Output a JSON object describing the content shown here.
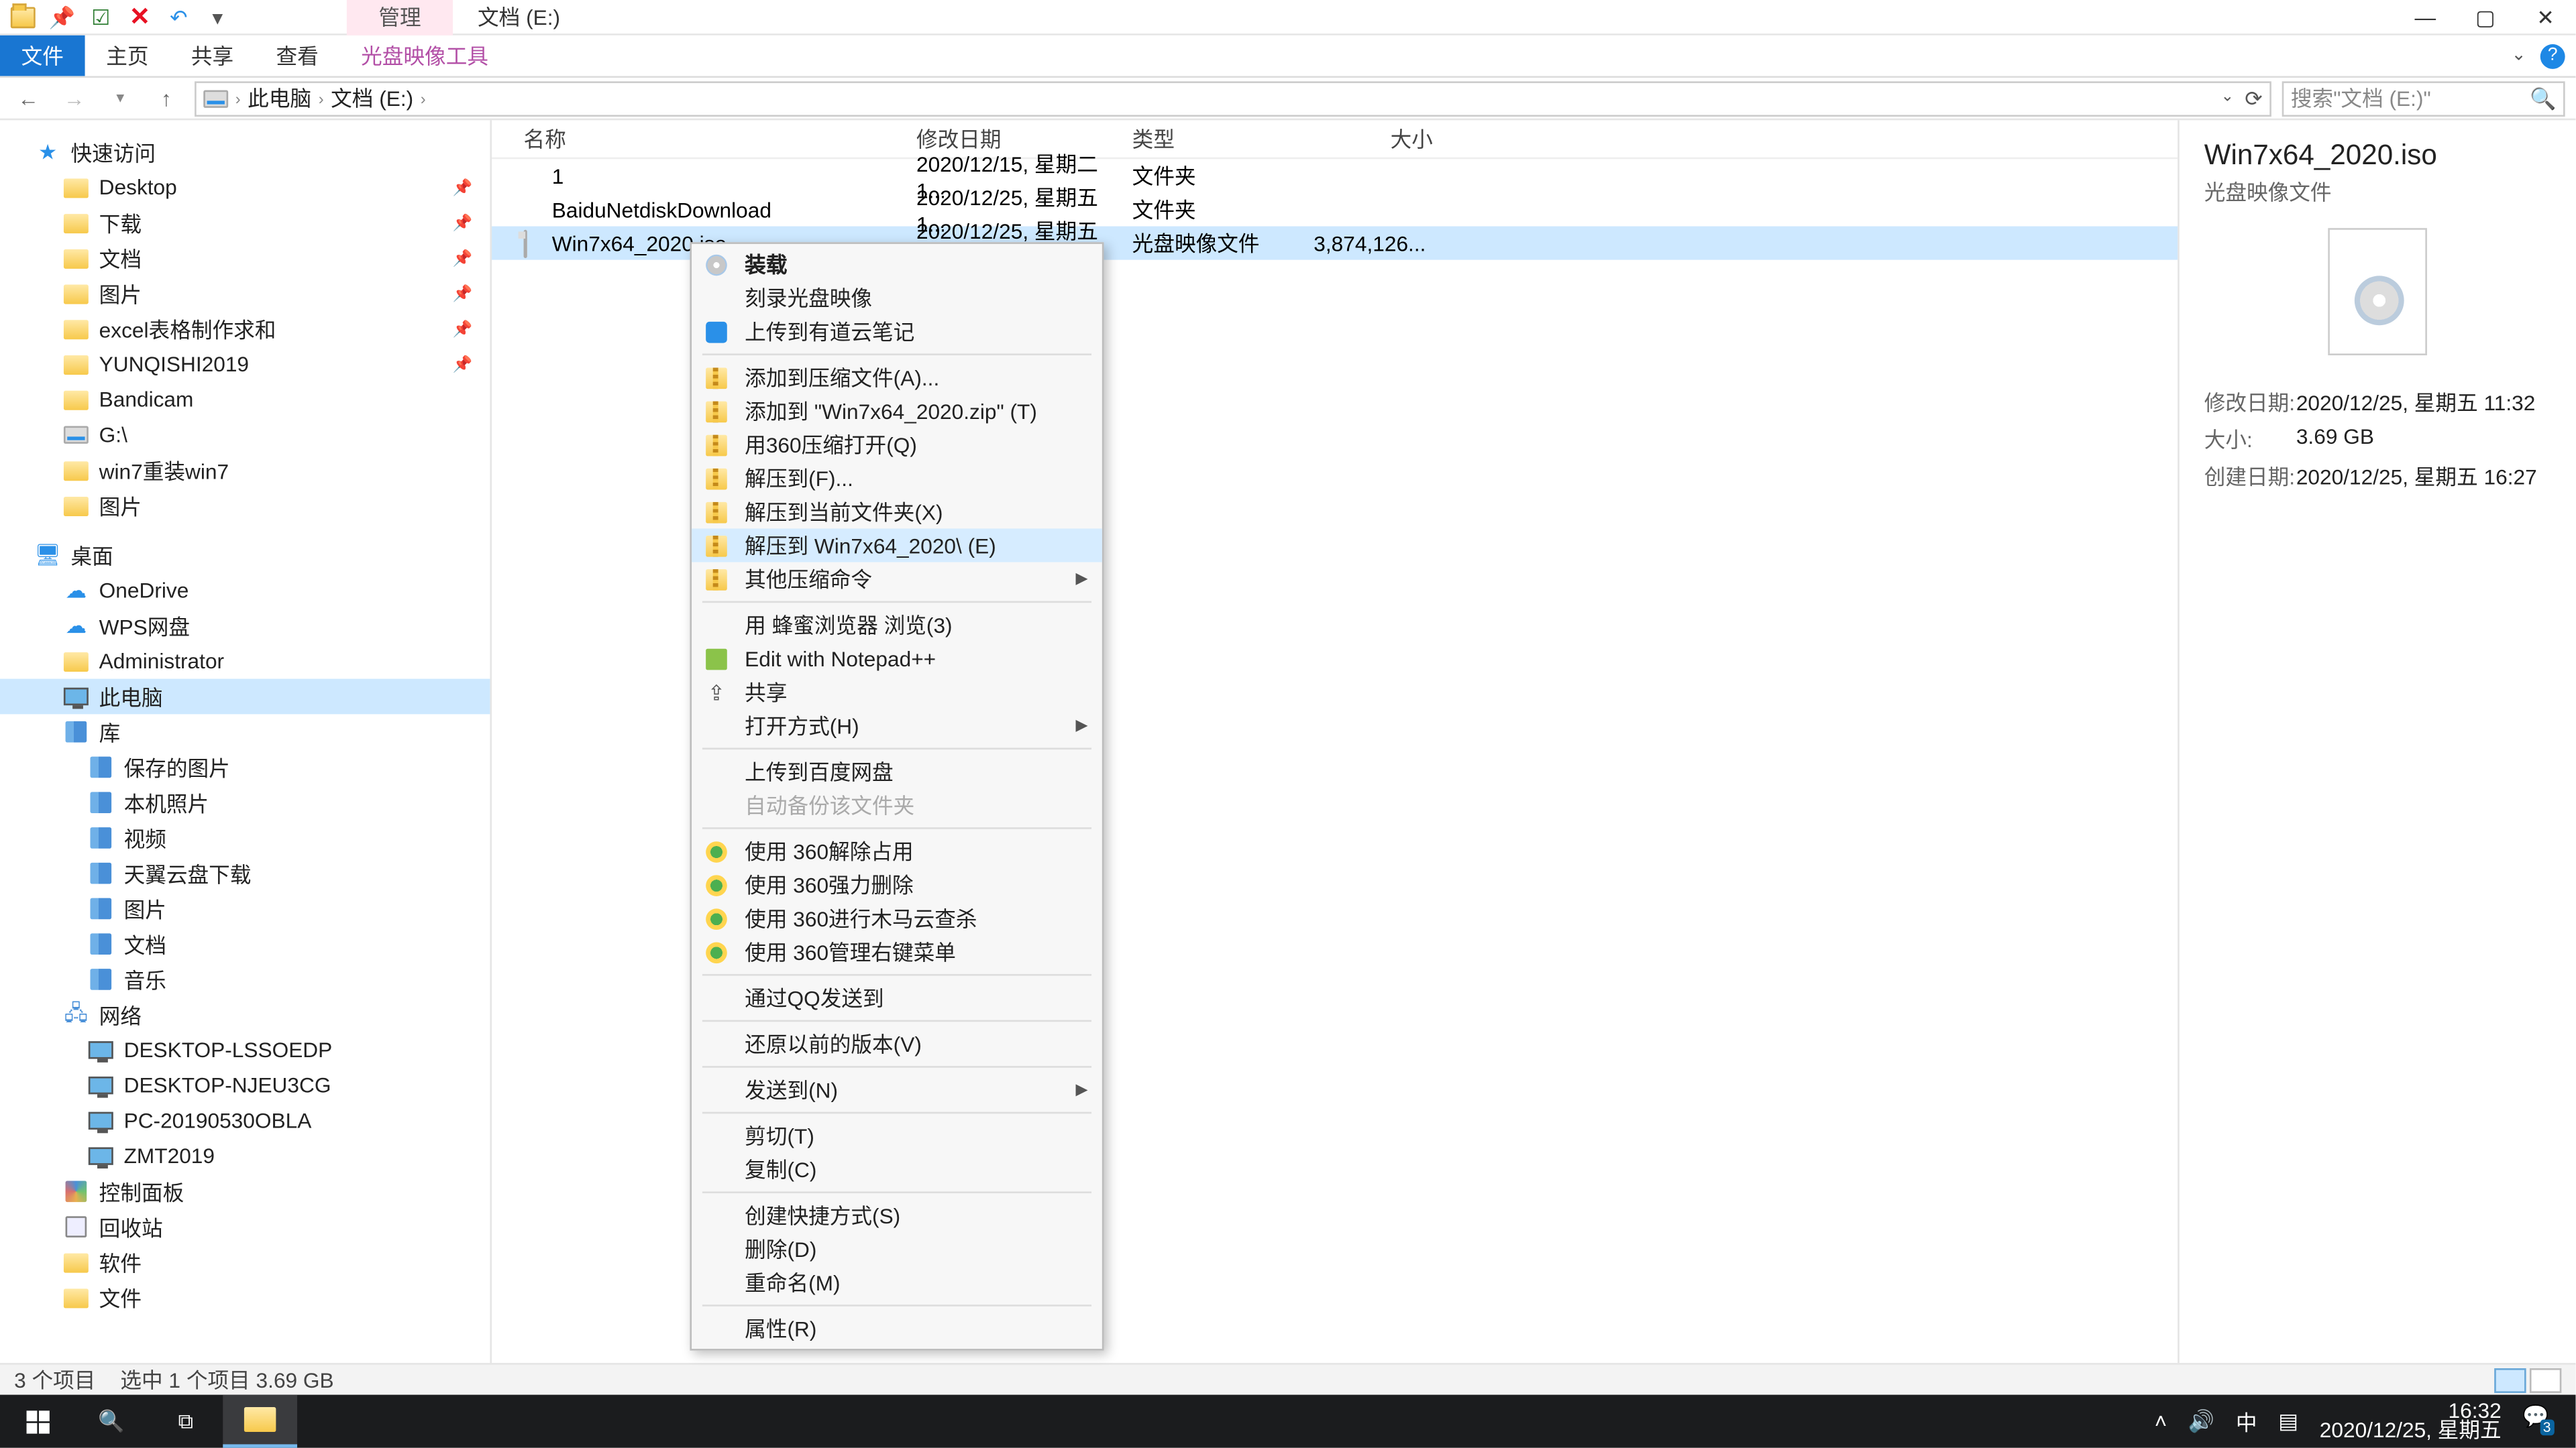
{
  "title_tabs": {
    "manage": "管理",
    "location": "文档 (E:)"
  },
  "ribbon": {
    "file": "文件",
    "home": "主页",
    "share": "共享",
    "view": "查看",
    "disc_tools": "光盘映像工具"
  },
  "address": {
    "root": "此电脑",
    "path": "文档 (E:)",
    "search_placeholder": "搜索\"文档 (E:)\""
  },
  "columns": {
    "name": "名称",
    "date": "修改日期",
    "type": "类型",
    "size": "大小"
  },
  "nav": {
    "quick_access": "快速访问",
    "quick_items": [
      {
        "label": "Desktop",
        "pinned": true
      },
      {
        "label": "下载",
        "pinned": true
      },
      {
        "label": "文档",
        "pinned": true
      },
      {
        "label": "图片",
        "pinned": true
      },
      {
        "label": "excel表格制作求和",
        "pinned": true
      },
      {
        "label": "YUNQISHI2019",
        "pinned": true
      },
      {
        "label": "Bandicam"
      },
      {
        "label": "G:\\"
      },
      {
        "label": "win7重装win7"
      },
      {
        "label": "图片"
      }
    ],
    "desktop": "桌面",
    "desktop_items": [
      {
        "label": "OneDrive",
        "icon": "cloud"
      },
      {
        "label": "WPS网盘",
        "icon": "cloud"
      },
      {
        "label": "Administrator",
        "icon": "folder"
      },
      {
        "label": "此电脑",
        "icon": "monitor",
        "selected": true
      },
      {
        "label": "库",
        "icon": "lib"
      }
    ],
    "lib_items": [
      "保存的图片",
      "本机照片",
      "视频",
      "天翼云盘下载",
      "图片",
      "文档",
      "音乐"
    ],
    "network": "网络",
    "net_items": [
      "DESKTOP-LSSOEDP",
      "DESKTOP-NJEU3CG",
      "PC-20190530OBLA",
      "ZMT2019"
    ],
    "ctrl": "控制面板",
    "recycle": "回收站",
    "software": "软件",
    "files": "文件"
  },
  "files": [
    {
      "name": "1",
      "date": "2020/12/15, 星期二 1...",
      "type": "文件夹",
      "size": "",
      "icon": "folder"
    },
    {
      "name": "BaiduNetdiskDownload",
      "date": "2020/12/25, 星期五 1...",
      "type": "文件夹",
      "size": "",
      "icon": "folder"
    },
    {
      "name": "Win7x64_2020.iso",
      "date": "2020/12/25, 星期五 1...",
      "type": "光盘映像文件",
      "size": "3,874,126...",
      "icon": "file",
      "selected": true
    }
  ],
  "context_menu": [
    {
      "label": "装载",
      "icon": "cd",
      "bold": true
    },
    {
      "label": "刻录光盘映像"
    },
    {
      "label": "上传到有道云笔记",
      "icon": "blue"
    },
    {
      "sep": true
    },
    {
      "label": "添加到压缩文件(A)...",
      "icon": "zip"
    },
    {
      "label": "添加到 \"Win7x64_2020.zip\" (T)",
      "icon": "zip"
    },
    {
      "label": "用360压缩打开(Q)",
      "icon": "zip"
    },
    {
      "label": "解压到(F)...",
      "icon": "zip"
    },
    {
      "label": "解压到当前文件夹(X)",
      "icon": "zip"
    },
    {
      "label": "解压到 Win7x64_2020\\ (E)",
      "icon": "zip",
      "hover": true
    },
    {
      "label": "其他压缩命令",
      "icon": "zip",
      "arrow": true
    },
    {
      "sep": true
    },
    {
      "label": "用 蜂蜜浏览器 浏览(3)"
    },
    {
      "label": "Edit with Notepad++",
      "icon": "np"
    },
    {
      "label": "共享",
      "icon": "share"
    },
    {
      "label": "打开方式(H)",
      "arrow": true
    },
    {
      "sep": true
    },
    {
      "label": "上传到百度网盘"
    },
    {
      "label": "自动备份该文件夹",
      "disabled": true
    },
    {
      "sep": true
    },
    {
      "label": "使用 360解除占用",
      "icon": "360"
    },
    {
      "label": "使用 360强力删除",
      "icon": "360"
    },
    {
      "label": "使用 360进行木马云查杀",
      "icon": "360"
    },
    {
      "label": "使用 360管理右键菜单",
      "icon": "360"
    },
    {
      "sep": true
    },
    {
      "label": "通过QQ发送到"
    },
    {
      "sep": true
    },
    {
      "label": "还原以前的版本(V)"
    },
    {
      "sep": true
    },
    {
      "label": "发送到(N)",
      "arrow": true
    },
    {
      "sep": true
    },
    {
      "label": "剪切(T)"
    },
    {
      "label": "复制(C)"
    },
    {
      "sep": true
    },
    {
      "label": "创建快捷方式(S)"
    },
    {
      "label": "删除(D)"
    },
    {
      "label": "重命名(M)"
    },
    {
      "sep": true
    },
    {
      "label": "属性(R)"
    }
  ],
  "preview": {
    "title": "Win7x64_2020.iso",
    "subtitle": "光盘映像文件",
    "rows": [
      {
        "k": "修改日期:",
        "v": "2020/12/25, 星期五 11:32"
      },
      {
        "k": "大小:",
        "v": "3.69 GB"
      },
      {
        "k": "创建日期:",
        "v": "2020/12/25, 星期五 16:27"
      }
    ]
  },
  "status": {
    "count": "3 个项目",
    "selection": "选中 1 个项目  3.69 GB"
  },
  "taskbar": {
    "ime": "中",
    "time": "16:32",
    "date": "2020/12/25, 星期五",
    "badge": "3"
  }
}
